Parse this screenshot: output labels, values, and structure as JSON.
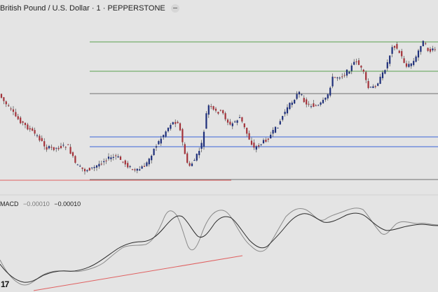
{
  "header": {
    "symbol": "British Pound / U.S. Dollar · 1 · PEPPERSTONE"
  },
  "macd": {
    "label": "MACD",
    "value1": "−0.00010",
    "value2": "−0.00010"
  },
  "logo_text": "17",
  "colors": {
    "background": "#e4e4e4",
    "candle_up": "#1e2f7a",
    "candle_down": "#a3323a",
    "level_green": "#5aa14e",
    "level_blue": "#3a64d8",
    "level_gray": "#707070",
    "trendline_red": "#e06060",
    "macd_line": "#2b2b2b",
    "signal_line": "#8a8a8a"
  }
}
